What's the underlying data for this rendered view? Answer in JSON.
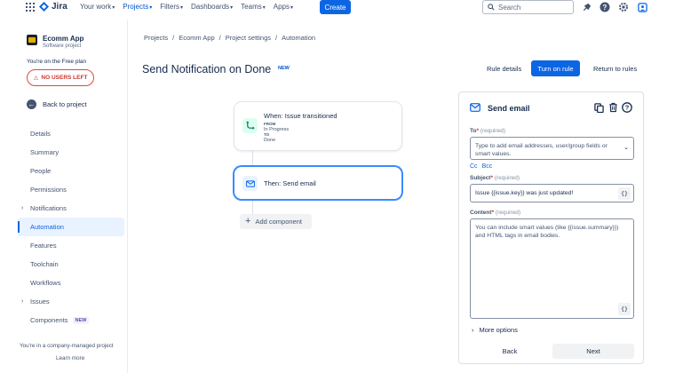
{
  "topnav": {
    "product": "Jira",
    "items": [
      {
        "label": "Your work"
      },
      {
        "label": "Projects"
      },
      {
        "label": "Filters"
      },
      {
        "label": "Dashboards"
      },
      {
        "label": "Teams"
      },
      {
        "label": "Apps"
      }
    ],
    "create_label": "Create",
    "search_placeholder": "Search",
    "accent": "#0c66e4",
    "icons": [
      "notifications-icon",
      "help-icon",
      "settings-icon",
      "profile-icon"
    ]
  },
  "sidebar": {
    "project_name": "Ecomm App",
    "project_type": "Software project",
    "plan_text": "You're on the Free plan",
    "users_left_label": "NO USERS LEFT",
    "back_label": "Back to project",
    "items": [
      {
        "label": "Details"
      },
      {
        "label": "Summary"
      },
      {
        "label": "People"
      },
      {
        "label": "Permissions"
      },
      {
        "label": "Notifications",
        "expandable": true
      },
      {
        "label": "Automation",
        "active": true
      },
      {
        "label": "Features"
      },
      {
        "label": "Toolchain"
      },
      {
        "label": "Workflows"
      },
      {
        "label": "Issues",
        "expandable": true
      },
      {
        "label": "Components",
        "badge": "NEW"
      }
    ],
    "footer_text": "You're in a company-managed project",
    "learn_more": "Learn more"
  },
  "main": {
    "breadcrumb": [
      "Projects",
      "Ecomm App",
      "Project settings",
      "Automation"
    ],
    "title": "Send Notification on Done",
    "title_badge": "NEW",
    "rule_details": "Rule details",
    "turn_on": "Turn on rule",
    "return": "Return to rules"
  },
  "canvas": {
    "trigger": {
      "title": "When: Issue transitioned",
      "from_label": "FROM",
      "from_value": "In Progress",
      "to_label": "TO",
      "to_value": "Done"
    },
    "action": {
      "title": "Then: Send email"
    },
    "add_component": "Add component"
  },
  "panel": {
    "title": "Send email",
    "to_label": "To",
    "to_required": "(required)",
    "to_placeholder": "Type to add email addresses, user/group fields or smart values.",
    "cc": "Cc",
    "bcc": "Bcc",
    "subject_label": "Subject",
    "subject_required": "(required)",
    "subject_value": "Issue {{issue.key}} was just updated!",
    "content_label": "Content",
    "content_required": "(required)",
    "content_placeholder": "You can include smart values (like {{issue.summary}}) and HTML tags in email bodies.",
    "smart_value_button": "{}",
    "more_options": "More options",
    "back": "Back",
    "next": "Next"
  }
}
